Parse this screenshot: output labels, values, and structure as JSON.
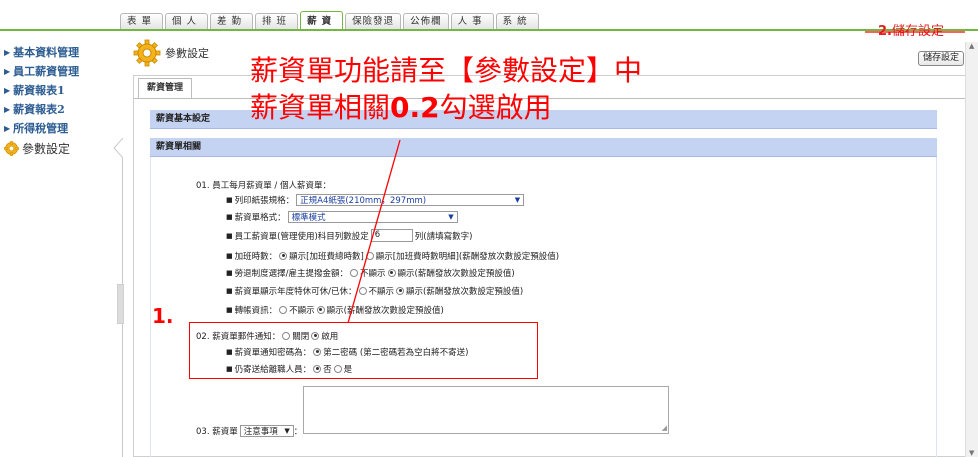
{
  "tabs": [
    {
      "label": "表單",
      "active": false
    },
    {
      "label": "個人",
      "active": false
    },
    {
      "label": "差勤",
      "active": false
    },
    {
      "label": "排班",
      "active": false
    },
    {
      "label": "薪資",
      "active": true
    },
    {
      "label": "保險發退",
      "active": false
    },
    {
      "label": "公佈欄",
      "active": false
    },
    {
      "label": "人事",
      "active": false
    },
    {
      "label": "系統",
      "active": false
    }
  ],
  "sidebar": {
    "items": [
      {
        "label": "基本資料管理"
      },
      {
        "label": "員工薪資管理"
      },
      {
        "label": "薪資報表1"
      },
      {
        "label": "薪資報表2"
      },
      {
        "label": "所得稅管理"
      },
      {
        "label": "參數設定",
        "active": true
      }
    ]
  },
  "page": {
    "title": "參數設定",
    "save_button": "儲存設定",
    "subtab": "薪資管理"
  },
  "sections": {
    "basic": "薪資基本設定",
    "payslip": "薪資單相關"
  },
  "payslip": {
    "item1_title": "01.  員工每月薪資單 / 個人薪資單：",
    "paper_label": "列印紙張規格：",
    "paper_value": "正規A4紙張(210mm，297mm)",
    "format_label": "薪資單格式：",
    "format_value": "標準模式",
    "columns_label": "員工薪資單(管理使用)科目列數設定",
    "columns_value": "6",
    "columns_hint": "列(請填寫數字)",
    "overtime_label": "加班時數：",
    "overtime_opt1": "顯示[加班費總時數]",
    "overtime_opt2": "顯示[加班費時數明細](薪酬發放次數設定預設值)",
    "labor_label": "勞退制度選擇/雇主提撥金額：",
    "labor_opt1": "不顯示",
    "labor_opt2": "顯示(薪酬發放次數設定預設值)",
    "leave_label": "薪資單顯示年度特休可休/已休：",
    "leave_opt1": "不顯示",
    "leave_opt2": "顯示(薪酬發放次數設定預設值)",
    "transfer_label": "轉帳資訊：",
    "transfer_opt1": "不顯示",
    "transfer_opt2": "顯示(薪酬發放次數設定預設值)",
    "item2_title": "02.  薪資單郵件通知：",
    "item2_opt1": "關閉",
    "item2_opt2": "啟用",
    "password_label": "薪資單通知密碼為：",
    "password_opt": "第二密碼 (第二密碼若為空白將不寄送)",
    "resigned_label": "仍寄送給離職人員：",
    "resigned_opt1": "否",
    "resigned_opt2": "是",
    "item3_prefix": "03.  薪資單",
    "item3_select": "注意事項",
    "item3_suffix": "："
  },
  "annotations": {
    "line1": "薪資單功能請至【參數設定】中",
    "line2_a": "薪資單相關",
    "line2_b": "0.2",
    "line2_c": "勾選啟用",
    "step1": "1.",
    "step2_num": "2.",
    "step2_text": "儲存設定",
    "color": "#ff0000"
  },
  "colors": {
    "accent_green": "#74b740",
    "section_header_bg": "#c5d3f3",
    "nav_link": "#2c5c92"
  }
}
